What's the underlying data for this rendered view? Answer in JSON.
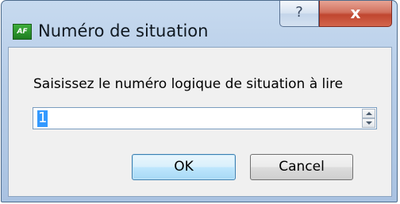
{
  "window": {
    "title": "Numéro de situation",
    "app_icon_text": "AF",
    "help_button_label": "?",
    "close_button_label": "x"
  },
  "dialog": {
    "prompt": "Saisissez le numéro logique de situation à lire",
    "spin_value": "1",
    "ok_label": "OK",
    "cancel_label": "Cancel"
  },
  "colors": {
    "selection": "#3399ff",
    "close_button": "#c0462f",
    "frame": "#b7cde8"
  }
}
